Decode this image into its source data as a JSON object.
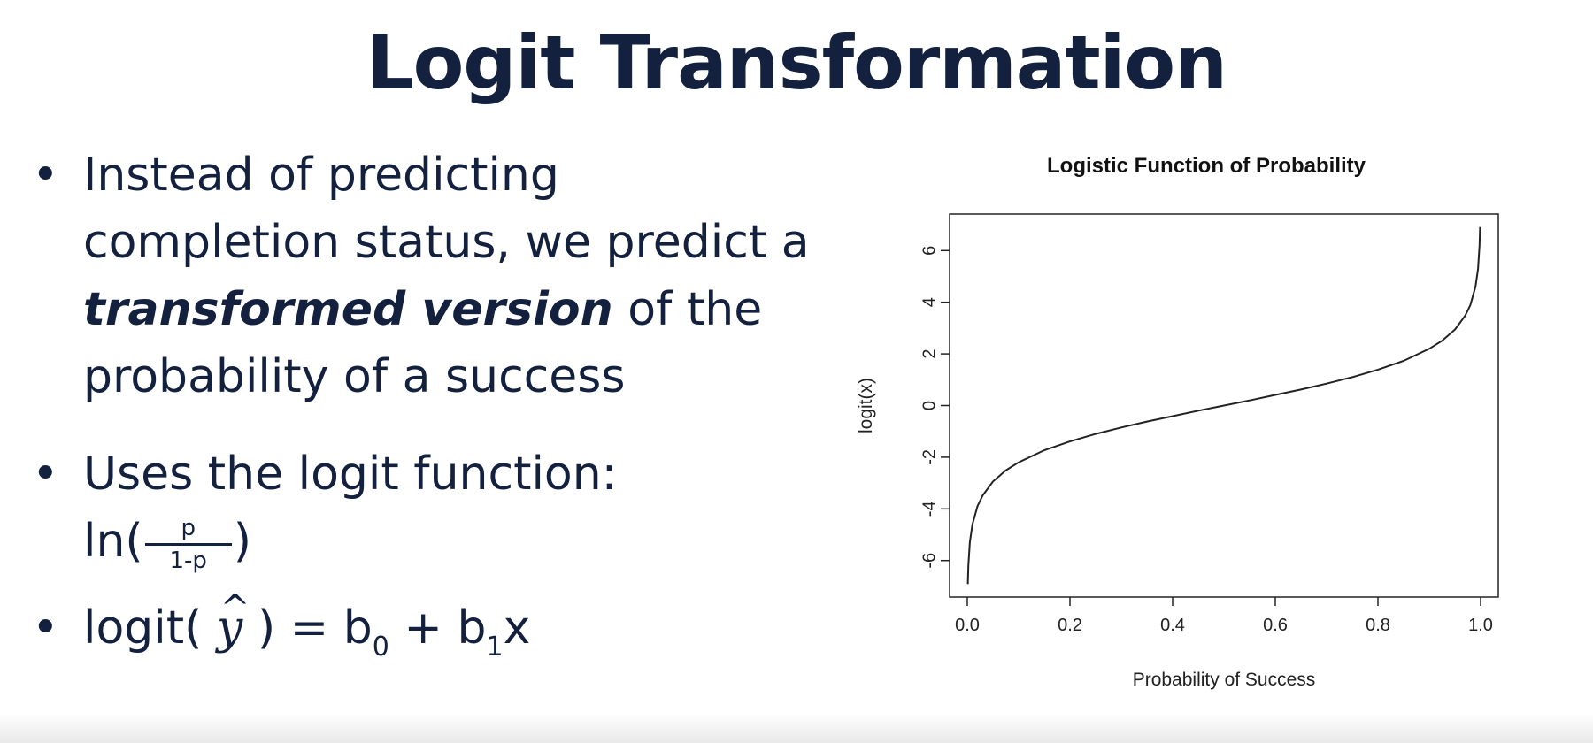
{
  "slide": {
    "title": "Logit Transformation",
    "bullets": {
      "b1_pre": "Instead of predicting completion status, we predict a ",
      "b1_em": "transformed version",
      "b1_post": " of the probability of a success",
      "b2": "Uses the logit function:",
      "fn_prefix": "ln(",
      "fn_num": "p",
      "fn_den": "1-p",
      "fn_suffix": ")",
      "b3_prefix": "logit( ",
      "b3_var": "y",
      "b3_hat": "^",
      "b3_mid": " ) = b",
      "b3_sub0": "0",
      "b3_plus": " + b",
      "b3_sub1": "1",
      "b3_x": "x"
    },
    "bullet_glyph": "•"
  },
  "chart_data": {
    "type": "line",
    "title": "Logistic Function of Probability",
    "xlabel": "Probability of Success",
    "ylabel": "logit(x)",
    "xlim": [
      0.0,
      1.0
    ],
    "ylim": [
      -6.9,
      6.9
    ],
    "xticks": [
      "0.0",
      "0.2",
      "0.4",
      "0.6",
      "0.8",
      "1.0"
    ],
    "yticks": [
      "-6",
      "-4",
      "-2",
      "0",
      "2",
      "4",
      "6"
    ],
    "grid": false,
    "series": [
      {
        "x": [
          0.001,
          0.002,
          0.005,
          0.01,
          0.02,
          0.03,
          0.05,
          0.075,
          0.1,
          0.15,
          0.2,
          0.25,
          0.3,
          0.35,
          0.4,
          0.45,
          0.5,
          0.55,
          0.6,
          0.65,
          0.7,
          0.75,
          0.8,
          0.85,
          0.9,
          0.925,
          0.95,
          0.97,
          0.98,
          0.99,
          0.995,
          0.998,
          0.999
        ],
        "y": [
          -6.91,
          -6.21,
          -5.29,
          -4.6,
          -3.89,
          -3.48,
          -2.94,
          -2.51,
          -2.2,
          -1.73,
          -1.39,
          -1.1,
          -0.85,
          -0.62,
          -0.41,
          -0.2,
          0.0,
          0.2,
          0.41,
          0.62,
          0.85,
          1.1,
          1.39,
          1.73,
          2.2,
          2.51,
          2.94,
          3.48,
          3.89,
          4.6,
          5.29,
          6.21,
          6.91
        ]
      }
    ],
    "color": "#222222"
  }
}
